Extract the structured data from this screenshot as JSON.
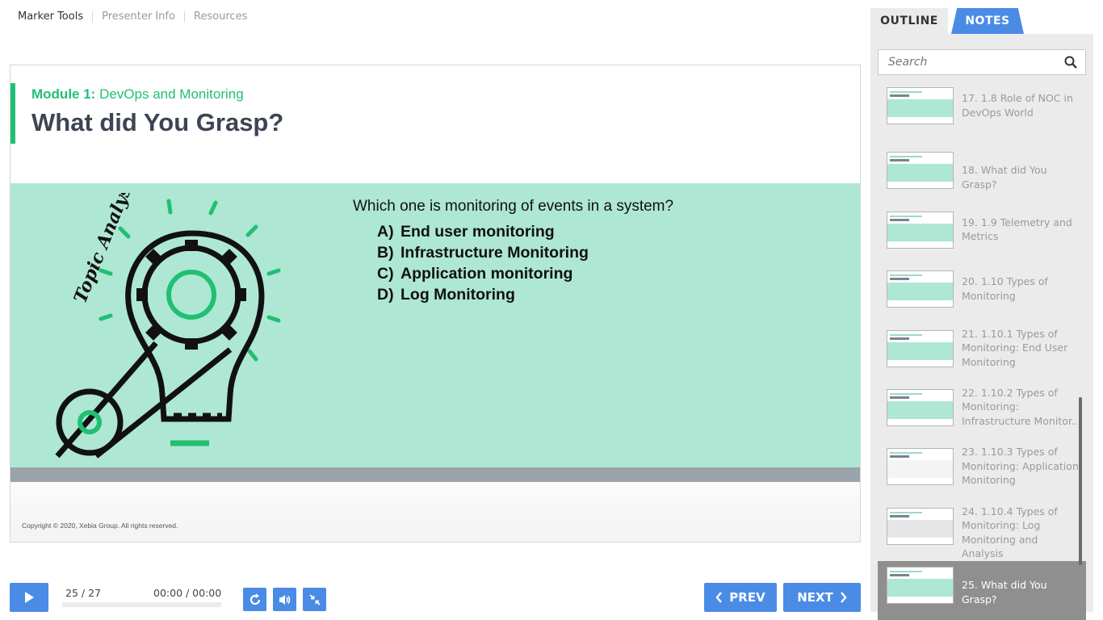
{
  "topnav": {
    "items": [
      "Marker Tools",
      "Presenter Info",
      "Resources"
    ]
  },
  "slide": {
    "module_prefix": "Module 1:",
    "module_name": "DevOps and Monitoring",
    "title": "What did You Grasp?",
    "illustration_text": "Topic Analysis",
    "question": "Which one is monitoring of events in a system?",
    "options": [
      {
        "letter": "A)",
        "text": "End user monitoring"
      },
      {
        "letter": "B)",
        "text": "Infrastructure Monitoring"
      },
      {
        "letter": "C)",
        "text": "Application monitoring"
      },
      {
        "letter": "D)",
        "text": "Log Monitoring"
      }
    ],
    "copyright": "Copyright © 2020, Xebia Group. All rights reserved.",
    "colors": {
      "accent": "#21bf73",
      "band": "#aee7d3",
      "title": "#3d4454"
    }
  },
  "player": {
    "counter": "25 / 27",
    "time": "00:00 / 00:00",
    "prev_label": "PREV",
    "next_label": "NEXT",
    "icons": [
      "play-icon",
      "replay-icon",
      "volume-icon",
      "shrink-icon"
    ],
    "accent": "#4a8be6"
  },
  "sidebar": {
    "tabs": {
      "outline": "OUTLINE",
      "notes": "NOTES"
    },
    "search_placeholder": "Search",
    "items": [
      {
        "label": "17. 1.8 Role of NOC in DevOps World",
        "active": false
      },
      {
        "label": "18. What did You Grasp?",
        "active": false
      },
      {
        "label": "19. 1.9 Telemetry and Metrics",
        "active": false
      },
      {
        "label": "20. 1.10 Types of Monitoring",
        "active": false
      },
      {
        "label": "21. 1.10.1 Types of Monitoring: End User Monitoring",
        "active": false
      },
      {
        "label": "22. 1.10.2 Types of Monitoring: Infrastructure Monitor...",
        "active": false
      },
      {
        "label": "23. 1.10.3 Types of Monitoring: Application Monitoring",
        "active": false
      },
      {
        "label": "24. 1.10.4 Types of Monitoring: Log Monitoring and Analysis",
        "active": false
      },
      {
        "label": "25. What did You Grasp?",
        "active": true
      }
    ]
  }
}
